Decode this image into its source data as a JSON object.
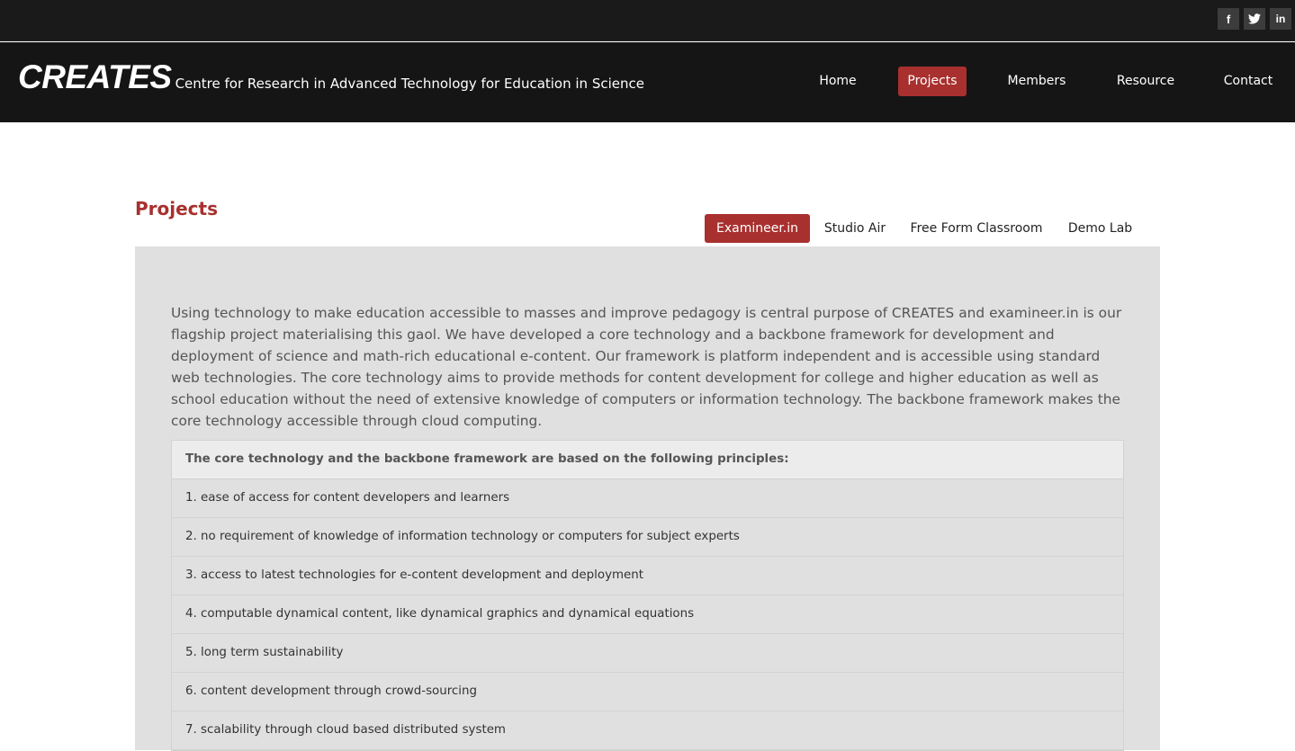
{
  "social": {
    "items": [
      {
        "name": "facebook",
        "glyph": "f"
      },
      {
        "name": "twitter",
        "glyph": ""
      },
      {
        "name": "linkedin",
        "glyph": "in"
      }
    ]
  },
  "header": {
    "logo": "CREATES",
    "tagline": "Centre for Research in Advanced Technology for Education in Science"
  },
  "nav": {
    "items": [
      {
        "label": "Home",
        "active": false
      },
      {
        "label": "Projects",
        "active": true
      },
      {
        "label": "Members",
        "active": false
      },
      {
        "label": "Resource",
        "active": false
      },
      {
        "label": "Contact",
        "active": false
      }
    ]
  },
  "main": {
    "title": "Projects",
    "tabs": [
      {
        "label": "Examineer.in",
        "active": true
      },
      {
        "label": "Studio Air",
        "active": false
      },
      {
        "label": "Free Form Classroom",
        "active": false
      },
      {
        "label": "Demo Lab",
        "active": false
      }
    ],
    "intro": "Using technology to make education accessible to masses and improve pedagogy is central purpose of CREATES and examineer.in is our flagship project materialising this gaol. We have developed a core technology and a backbone framework for development and deployment of science and math-rich educational e-content. Our framework is platform independent and is accessible using standard web technologies. The core technology aims to provide methods for content development for college and higher education as well as school education without the need of extensive knowledge of computers or information technology. The backbone framework makes the core technology accessible through cloud computing.",
    "principles_heading": "The core technology and the backbone framework are based on the following principles:",
    "principles": [
      "1. ease of access for content developers and learners",
      "2. no requirement of knowledge of information technology or computers for subject experts",
      "3. access to latest technologies for e-content development and deployment",
      "4. computable dynamical content, like dynamical graphics and dynamical equations",
      "5. long term sustainability",
      "6. content development through crowd-sourcing",
      "7. scalability through cloud based distributed system"
    ]
  },
  "colors": {
    "accent": "#a8302e",
    "header_bg": "#151515",
    "panel_bg": "#e0e0e0"
  }
}
